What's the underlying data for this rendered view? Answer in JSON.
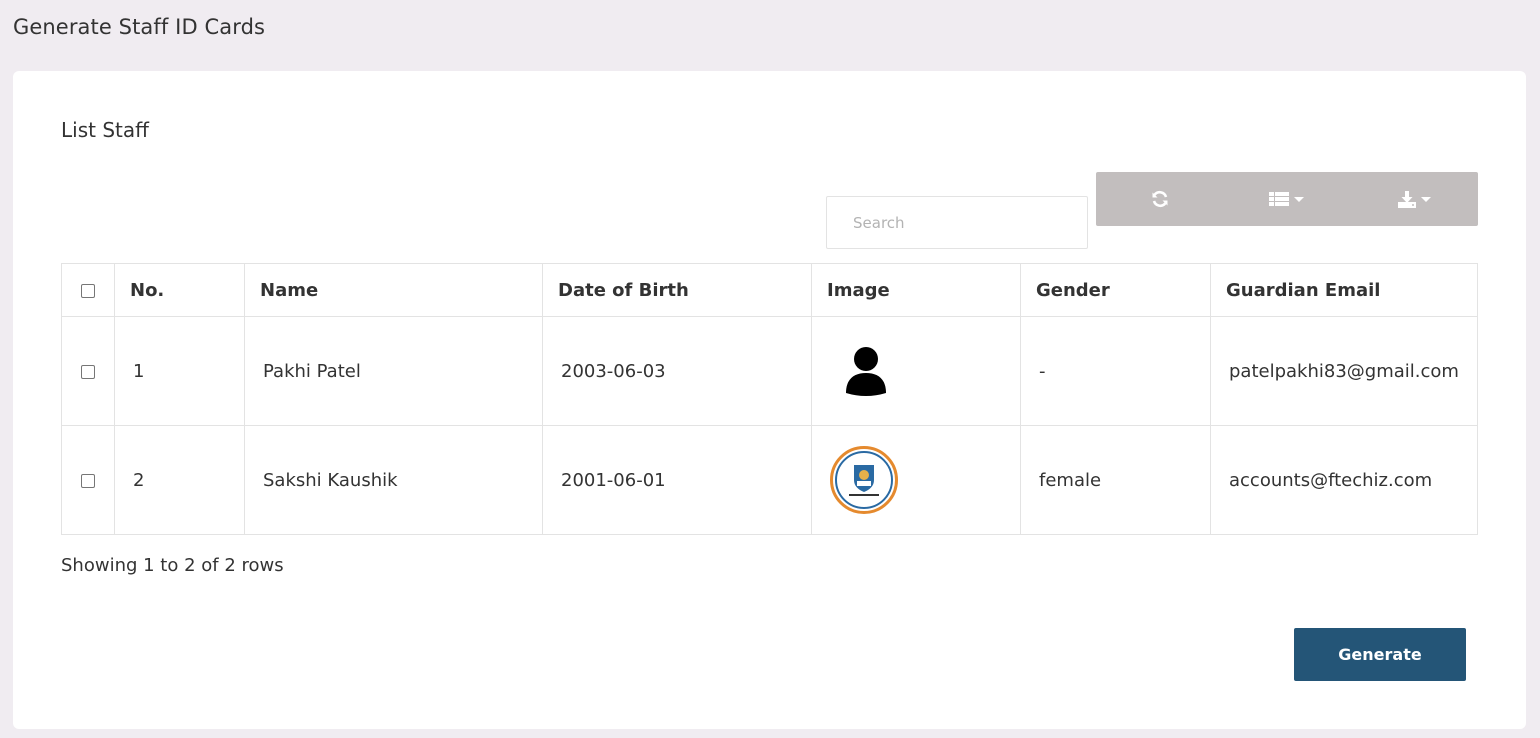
{
  "page": {
    "title": "Generate Staff ID Cards"
  },
  "card": {
    "title": "List Staff"
  },
  "search": {
    "placeholder": "Search"
  },
  "toolbar": {
    "buttons": [
      {
        "icon": "refresh-icon"
      },
      {
        "icon": "columns-list-icon"
      },
      {
        "icon": "export-download-icon"
      }
    ]
  },
  "table": {
    "columns": [
      "No.",
      "Name",
      "Date of Birth",
      "Image",
      "Gender",
      "Guardian Email"
    ],
    "rows": [
      {
        "no": "1",
        "name": "Pakhi Patel",
        "dob": "2003-06-03",
        "image": "user-silhouette-icon",
        "gender": "-",
        "email": "patelpakhi83@gmail.com"
      },
      {
        "no": "2",
        "name": "Sakshi Kaushik",
        "dob": "2001-06-01",
        "image": "school-logo",
        "gender": "female",
        "email": "accounts@ftechiz.com"
      }
    ]
  },
  "footer": {
    "rows_info": "Showing 1 to 2 of 2 rows"
  },
  "actions": {
    "generate_label": "Generate"
  },
  "colors": {
    "background": "#f0ecf1",
    "toolbar": "#c2bebe",
    "primary_button": "#245577"
  }
}
